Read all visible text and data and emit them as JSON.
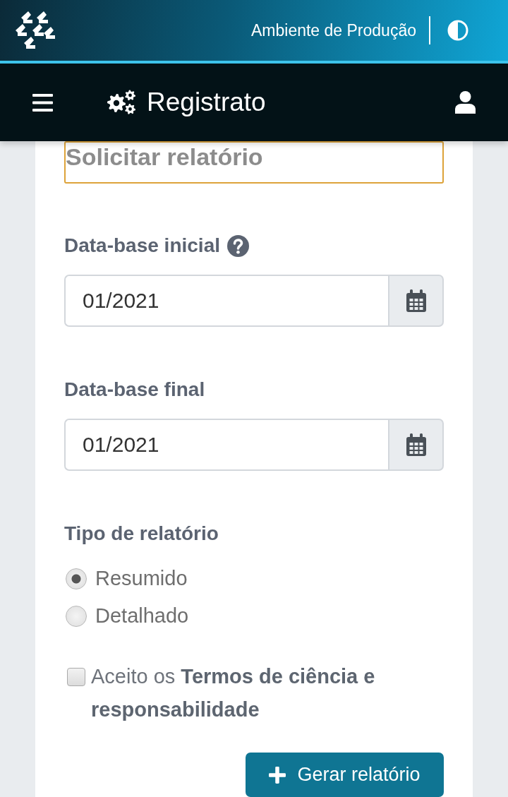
{
  "header": {
    "environment": "Ambiente de Produção"
  },
  "navbar": {
    "title": "Registrato"
  },
  "form": {
    "heading": {
      "text": "Solicitar relatório",
      "focused": true
    },
    "fields": [
      {
        "label": "Data-base inicial",
        "help": true,
        "value": "01/2021"
      },
      {
        "label": "Data-base final",
        "help": false,
        "value": "01/2021"
      }
    ],
    "report_type": {
      "label": "Tipo de relatório",
      "options": [
        {
          "label": "Resumido",
          "selected": true
        },
        {
          "label": "Detalhado",
          "selected": false
        }
      ]
    },
    "terms": {
      "text": "Aceito os **Termos de ciência e responsabilidade**",
      "checked": false
    },
    "submit": {
      "label": "Gerar relatório"
    }
  }
}
